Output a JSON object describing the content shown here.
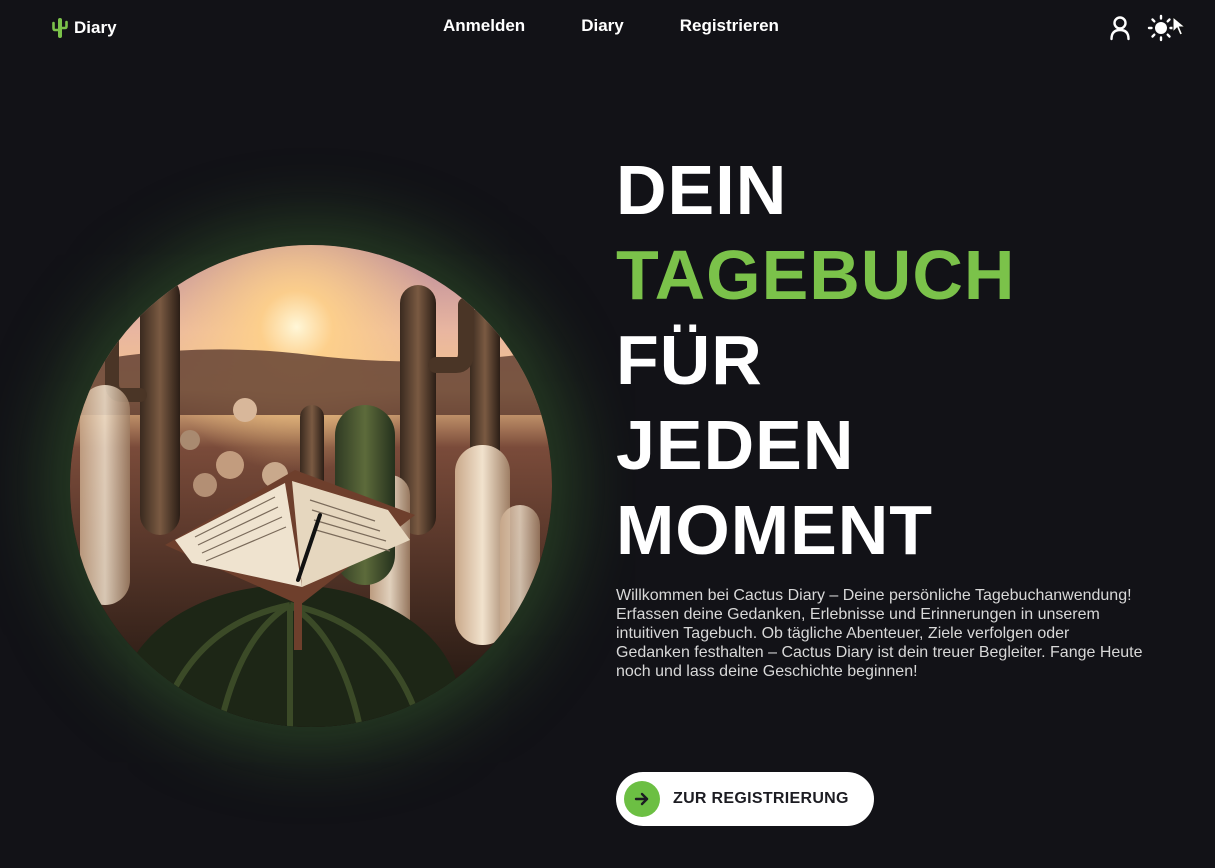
{
  "header": {
    "brand": {
      "name": "Diary",
      "icon": "cactus-icon",
      "accent_color": "#7bc24a"
    },
    "nav": [
      {
        "label": "Anmelden"
      },
      {
        "label": "Diary"
      },
      {
        "label": "Registrieren"
      }
    ],
    "actions": {
      "user_icon": "user-icon",
      "theme_icon": "sun-icon"
    }
  },
  "hero": {
    "image_subject": "Open diary among cactuses at sunset",
    "headline": {
      "line1": "DEIN",
      "line2": "TAGEBUCH",
      "line3": "FÜR",
      "line4": "JEDEN",
      "line5": "MOMENT"
    },
    "intro": "Willkommen bei Cactus Diary – Deine persönliche Tagebuchanwendung! Erfassen deine Gedanken, Erlebnisse und Erinnerungen in unserem intuitiven Tagebuch. Ob tägliche Abenteuer, Ziele verfolgen oder Gedanken festhalten – Cactus Diary ist dein treuer Begleiter. Fange Heute noch und lass deine Geschichte beginnen!",
    "cta": {
      "label": "ZUR REGISTRIERUNG",
      "icon": "arrow-right-icon"
    }
  },
  "colors": {
    "background": "#121217",
    "accent": "#7bc24a",
    "text": "#ffffff",
    "button_bg": "#ffffff"
  }
}
